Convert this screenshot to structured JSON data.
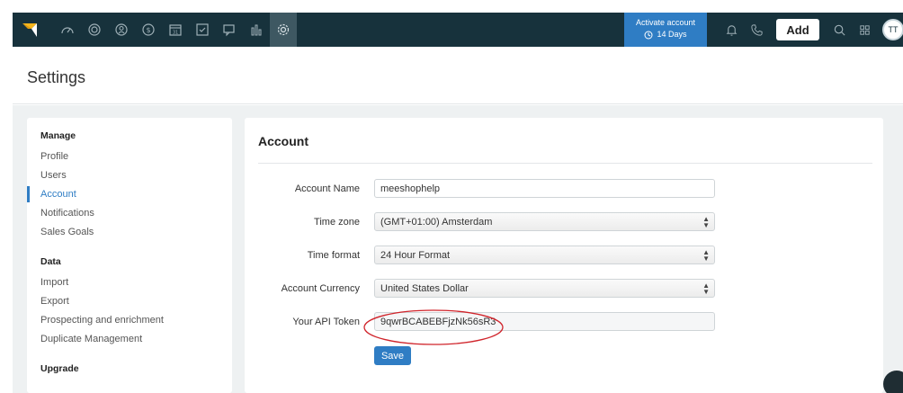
{
  "topbar": {
    "activate_label": "Activate account",
    "days_label": "14 Days",
    "add_label": "Add",
    "avatar_initials": "TT"
  },
  "page": {
    "title": "Settings"
  },
  "sidebar": {
    "sections": [
      {
        "title": "Manage",
        "items": [
          "Profile",
          "Users",
          "Account",
          "Notifications",
          "Sales Goals"
        ]
      },
      {
        "title": "Data",
        "items": [
          "Import",
          "Export",
          "Prospecting and enrichment",
          "Duplicate Management"
        ]
      },
      {
        "title": "Upgrade",
        "items": []
      }
    ],
    "active_item": "Account"
  },
  "account": {
    "title": "Account",
    "name_label": "Account Name",
    "name_value": "meeshophelp",
    "timezone_label": "Time zone",
    "timezone_value": "(GMT+01:00) Amsterdam",
    "timeformat_label": "Time format",
    "timeformat_value": "24 Hour Format",
    "currency_label": "Account Currency",
    "currency_value": "United States Dollar",
    "api_label": "Your API Token",
    "api_value": "9qwrBCABEBFjzNk56sR3",
    "save_label": "Save"
  },
  "colors": {
    "topbar": "#17323c",
    "accent": "#2f7dc4",
    "highlight": "#d0242b",
    "logo_yellow": "#f5b51c"
  }
}
